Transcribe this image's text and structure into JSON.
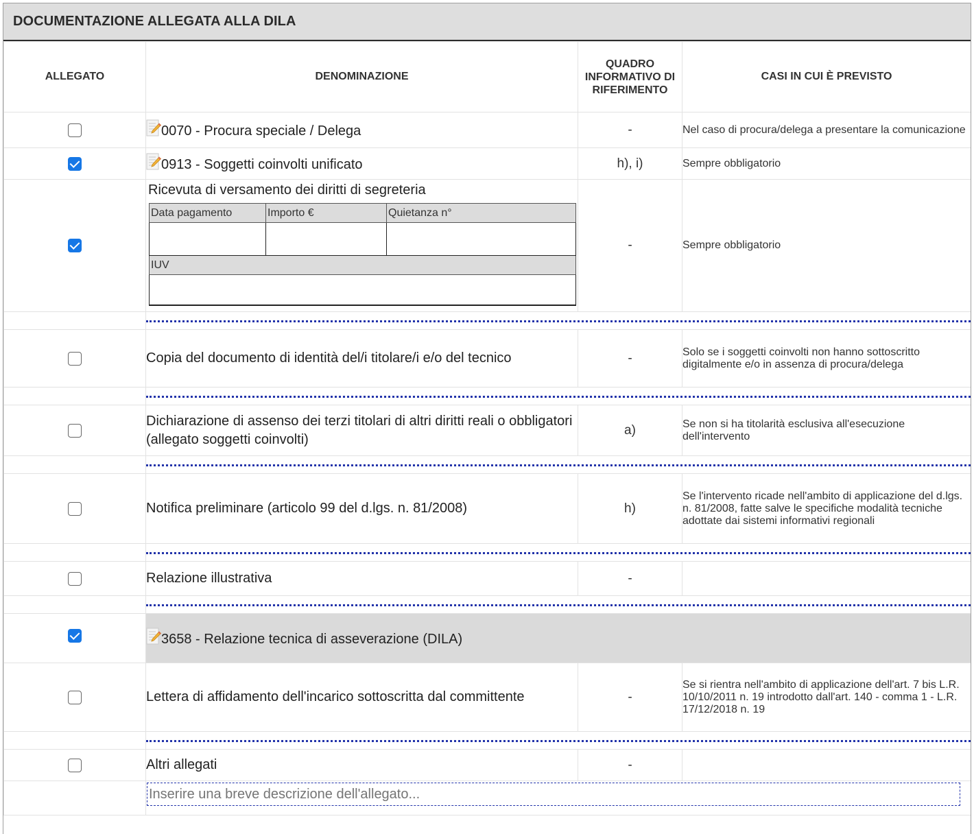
{
  "panel": {
    "title": "DOCUMENTAZIONE ALLEGATA ALLA DILA"
  },
  "columns": {
    "allegato": "ALLEGATO",
    "denominazione": "DENOMINAZIONE",
    "quadro": "QUADRO INFORMATIVO DI RIFERIMENTO",
    "casi": "CASI IN CUI È PREVISTO"
  },
  "rows": {
    "r0070": {
      "checked": false,
      "icon": "document-edit-icon",
      "label": "0070 - Procura speciale / Delega",
      "quadro": "-",
      "casi": "Nel caso di procura/delega a presentare la comunicazione"
    },
    "r0913": {
      "checked": true,
      "icon": "document-edit-icon",
      "label": "0913 - Soggetti coinvolti unificato",
      "quadro": "h), i)",
      "casi": "Sempre obbligatorio"
    },
    "ricevuta": {
      "checked": true,
      "label": "Ricevuta di versamento dei diritti di segreteria",
      "fields": {
        "data_pagamento": "Data pagamento",
        "importo": "Importo €",
        "quietanza": "Quietanza n°",
        "iuv": "IUV"
      },
      "quadro": "-",
      "casi": "Sempre obbligatorio"
    },
    "identita": {
      "checked": false,
      "label": "Copia del documento di identità del/i titolare/i e/o del tecnico",
      "quadro": "-",
      "casi": "Solo se i soggetti coinvolti non hanno sottoscritto digitalmente e/o in assenza di procura/delega"
    },
    "assenso": {
      "checked": false,
      "label": "Dichiarazione di assenso dei terzi titolari di altri diritti reali o obbligatori (allegato soggetti coinvolti)",
      "quadro": "a)",
      "casi": "Se non si ha titolarità esclusiva all'esecuzione dell'intervento"
    },
    "notifica": {
      "checked": false,
      "label": "Notifica preliminare (articolo 99 del d.lgs. n. 81/2008)",
      "quadro": "h)",
      "casi": "Se l'intervento ricade nell'ambito di applicazione del d.lgs. n. 81/2008, fatte salve le specifiche modalità tecniche adottate dai sistemi informativi regionali"
    },
    "relazione": {
      "checked": false,
      "label": "Relazione illustrativa",
      "quadro": "-",
      "casi": ""
    },
    "r3658": {
      "checked": true,
      "icon": "document-edit-icon",
      "label": "3658 - Relazione tecnica di asseverazione (DILA)"
    },
    "lettera": {
      "checked": false,
      "label": "Lettera di affidamento dell'incarico sottoscritta dal committente",
      "quadro": "-",
      "casi": "Se si rientra nell'ambito di applicazione dell'art. 7 bis L.R. 10/10/2011 n. 19 introdotto dall'art. 140 - comma 1 - L.R. 17/12/2018 n. 19"
    },
    "altri": {
      "checked": false,
      "label": "Altri allegati",
      "quadro": "-",
      "casi": "",
      "description_placeholder": "Inserire una breve descrizione dell'allegato...",
      "description_value": ""
    }
  },
  "colors": {
    "checkbox_checked": "#1677e6",
    "separator": "#2233aa",
    "header_bg": "#dedede"
  }
}
